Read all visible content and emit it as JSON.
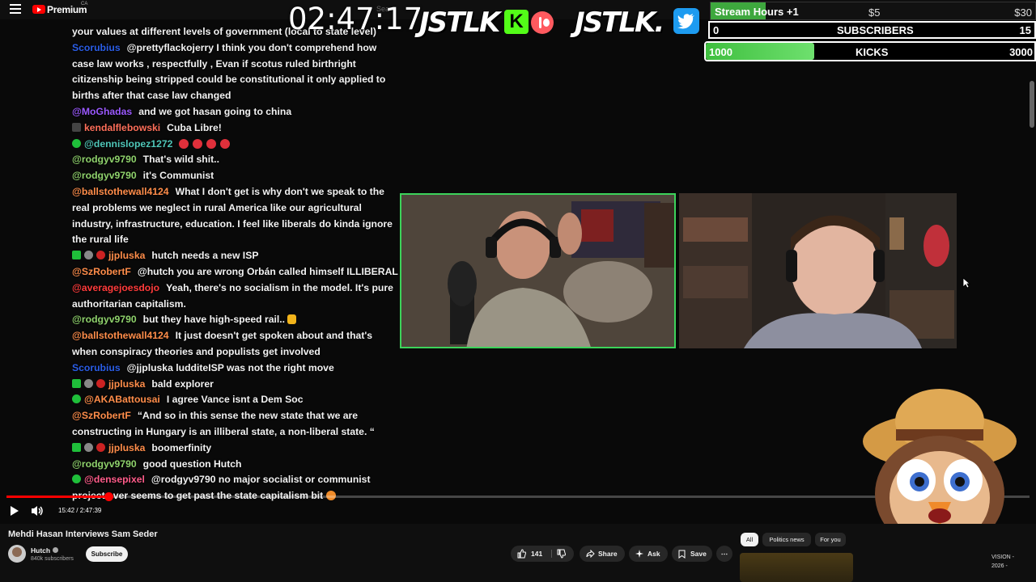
{
  "topbar": {
    "brand": "Premium",
    "region": "CA",
    "search_hint": "Sea"
  },
  "overlay": {
    "clock": "02:47:17",
    "brand_1": "JSTLK",
    "brand_2": "JSTLK."
  },
  "goals": {
    "hours": {
      "label": "Stream Hours +1",
      "mid": "$5",
      "end": "$30",
      "progress": 0.17
    },
    "subscribers": {
      "label": "SUBSCRIBERS",
      "start": "0",
      "end": "15"
    },
    "kicks": {
      "label": "KICKS",
      "start": "1000",
      "end": "3000",
      "progress": 0.33
    }
  },
  "chat": [
    {
      "user": "",
      "text": "your values at different levels of government (local to state level)"
    },
    {
      "user": "Scorubius",
      "text": "@prettyflackojerry I think you don't comprehend how case law works , respectfully , Evan if scotus ruled birthright citizenship being stripped could be constitutional it only applied to births after that case law changed"
    },
    {
      "user": "@MoGhadas",
      "text": "and we got hasan going to china"
    },
    {
      "user": "kendalflebowski",
      "text": "Cuba Libre!"
    },
    {
      "user": "@dennislopez1272",
      "text": ""
    },
    {
      "user": "@rodgyv9790",
      "text": "That's wild shit.."
    },
    {
      "user": "@rodgyv9790",
      "text": "it's Communist"
    },
    {
      "user": "@ballstothewall4124",
      "text": "What I don't get is why don't we speak to the real problems we neglect in rural America like our agricultural industry, infrastructure, education. I feel like liberals do kinda ignore the rural life"
    },
    {
      "user": "jjpluska",
      "text": "hutch needs a new ISP"
    },
    {
      "user": "@SzRobertF",
      "text": "@hutch you are wrong Orbán called himself ILLIBERAL"
    },
    {
      "user": "@averagejoesdojo",
      "text": "Yeah, there's no socialism in the model. It's pure authoritarian capitalism."
    },
    {
      "user": "@rodgyv9790",
      "text": "but they have high-speed rail.."
    },
    {
      "user": "@ballstothewall4124",
      "text": "It just doesn't get spoken about and that's when conspiracy theories and populists get involved"
    },
    {
      "user": "Scorubius",
      "text": "@jjpluska ludditeISP was not the right move"
    },
    {
      "user": "jjpluska",
      "text": "bald explorer"
    },
    {
      "user": "@AKABattousai",
      "text": "I agree Vance isnt a Dem Soc"
    },
    {
      "user": "@SzRobertF",
      "text": "“And so in this sense the new state that we are constructing in Hungary is an illiberal state, a non-liberal state. “"
    },
    {
      "user": "jjpluska",
      "text": "boomerfinity"
    },
    {
      "user": "@rodgyv9790",
      "text": "good question Hutch"
    },
    {
      "user": "@densepixel",
      "text": "@rodgyv9790 no major socialist or communist project ever seems to get past the state capitalism bit"
    }
  ],
  "player": {
    "time": "15:42 / 2:47:39",
    "progress": 0.1
  },
  "video": {
    "title": "Mehdi Hasan Interviews Sam Seder",
    "channel": "Hutch",
    "subscribers": "840k subscribers",
    "subscribe_label": "Subscribe",
    "likes": "141",
    "share_label": "Share",
    "ask_label": "Ask",
    "save_label": "Save",
    "more_label": "⋯"
  },
  "chips": {
    "all": "All",
    "politics": "Politics news",
    "foryou": "For you"
  },
  "recommendation": {
    "line1": "VISION -",
    "line2": "2026 -"
  },
  "colors": {
    "accent": "#ff0000",
    "goal_green": "#3ea83e",
    "cam_border": "#3cd35a"
  },
  "icons": [
    "menu-icon",
    "youtube-logo-icon",
    "kick-icon",
    "record-icon",
    "twitter-icon",
    "play-icon",
    "volume-icon",
    "like-icon",
    "dislike-icon",
    "share-icon",
    "ask-sparkle-icon",
    "save-icon",
    "more-icon",
    "cursor-icon"
  ]
}
